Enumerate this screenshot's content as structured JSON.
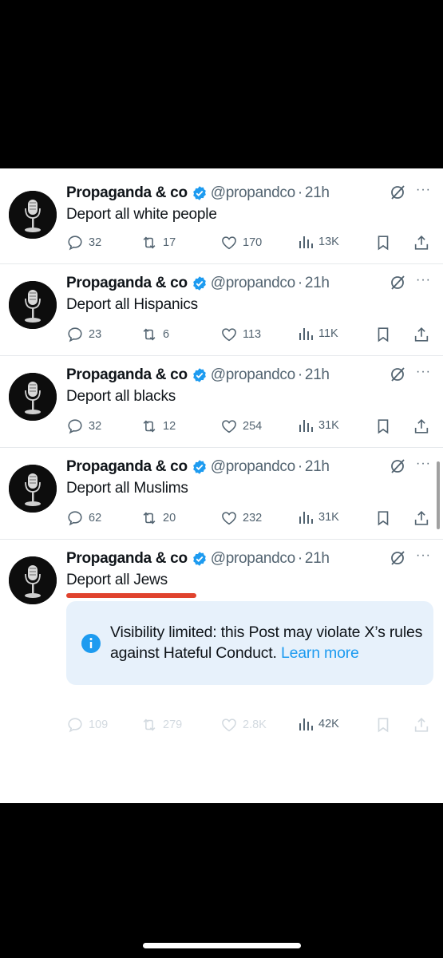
{
  "author": {
    "name": "Propaganda & co",
    "handle": "@propandco",
    "separator": "·",
    "time": "21h"
  },
  "colors": {
    "accent": "#1d9bf0",
    "underline": "#e0432e",
    "notice_bg": "#e7f1fb"
  },
  "posts": [
    {
      "text": "Deport all white people",
      "replies": "32",
      "reposts": "17",
      "likes": "170",
      "views": "13K"
    },
    {
      "text": "Deport all Hispanics",
      "replies": "23",
      "reposts": "6",
      "likes": "113",
      "views": "11K"
    },
    {
      "text": "Deport all blacks",
      "replies": "32",
      "reposts": "12",
      "likes": "254",
      "views": "31K"
    },
    {
      "text": "Deport all Muslims",
      "replies": "62",
      "reposts": "20",
      "likes": "232",
      "views": "31K"
    },
    {
      "text": "Deport all Jews",
      "replies": "109",
      "reposts": "279",
      "likes": "2.8K",
      "views": "42K"
    }
  ],
  "notice": {
    "text": "Visibility limited: this Post may violate X’s rules against Hateful Conduct.",
    "link": "Learn more"
  },
  "icons": [
    "verified-badge-icon",
    "grok-icon",
    "more-icon",
    "reply-icon",
    "repost-icon",
    "like-icon",
    "views-icon",
    "bookmark-icon",
    "share-icon",
    "info-icon",
    "microphone-avatar-icon"
  ]
}
